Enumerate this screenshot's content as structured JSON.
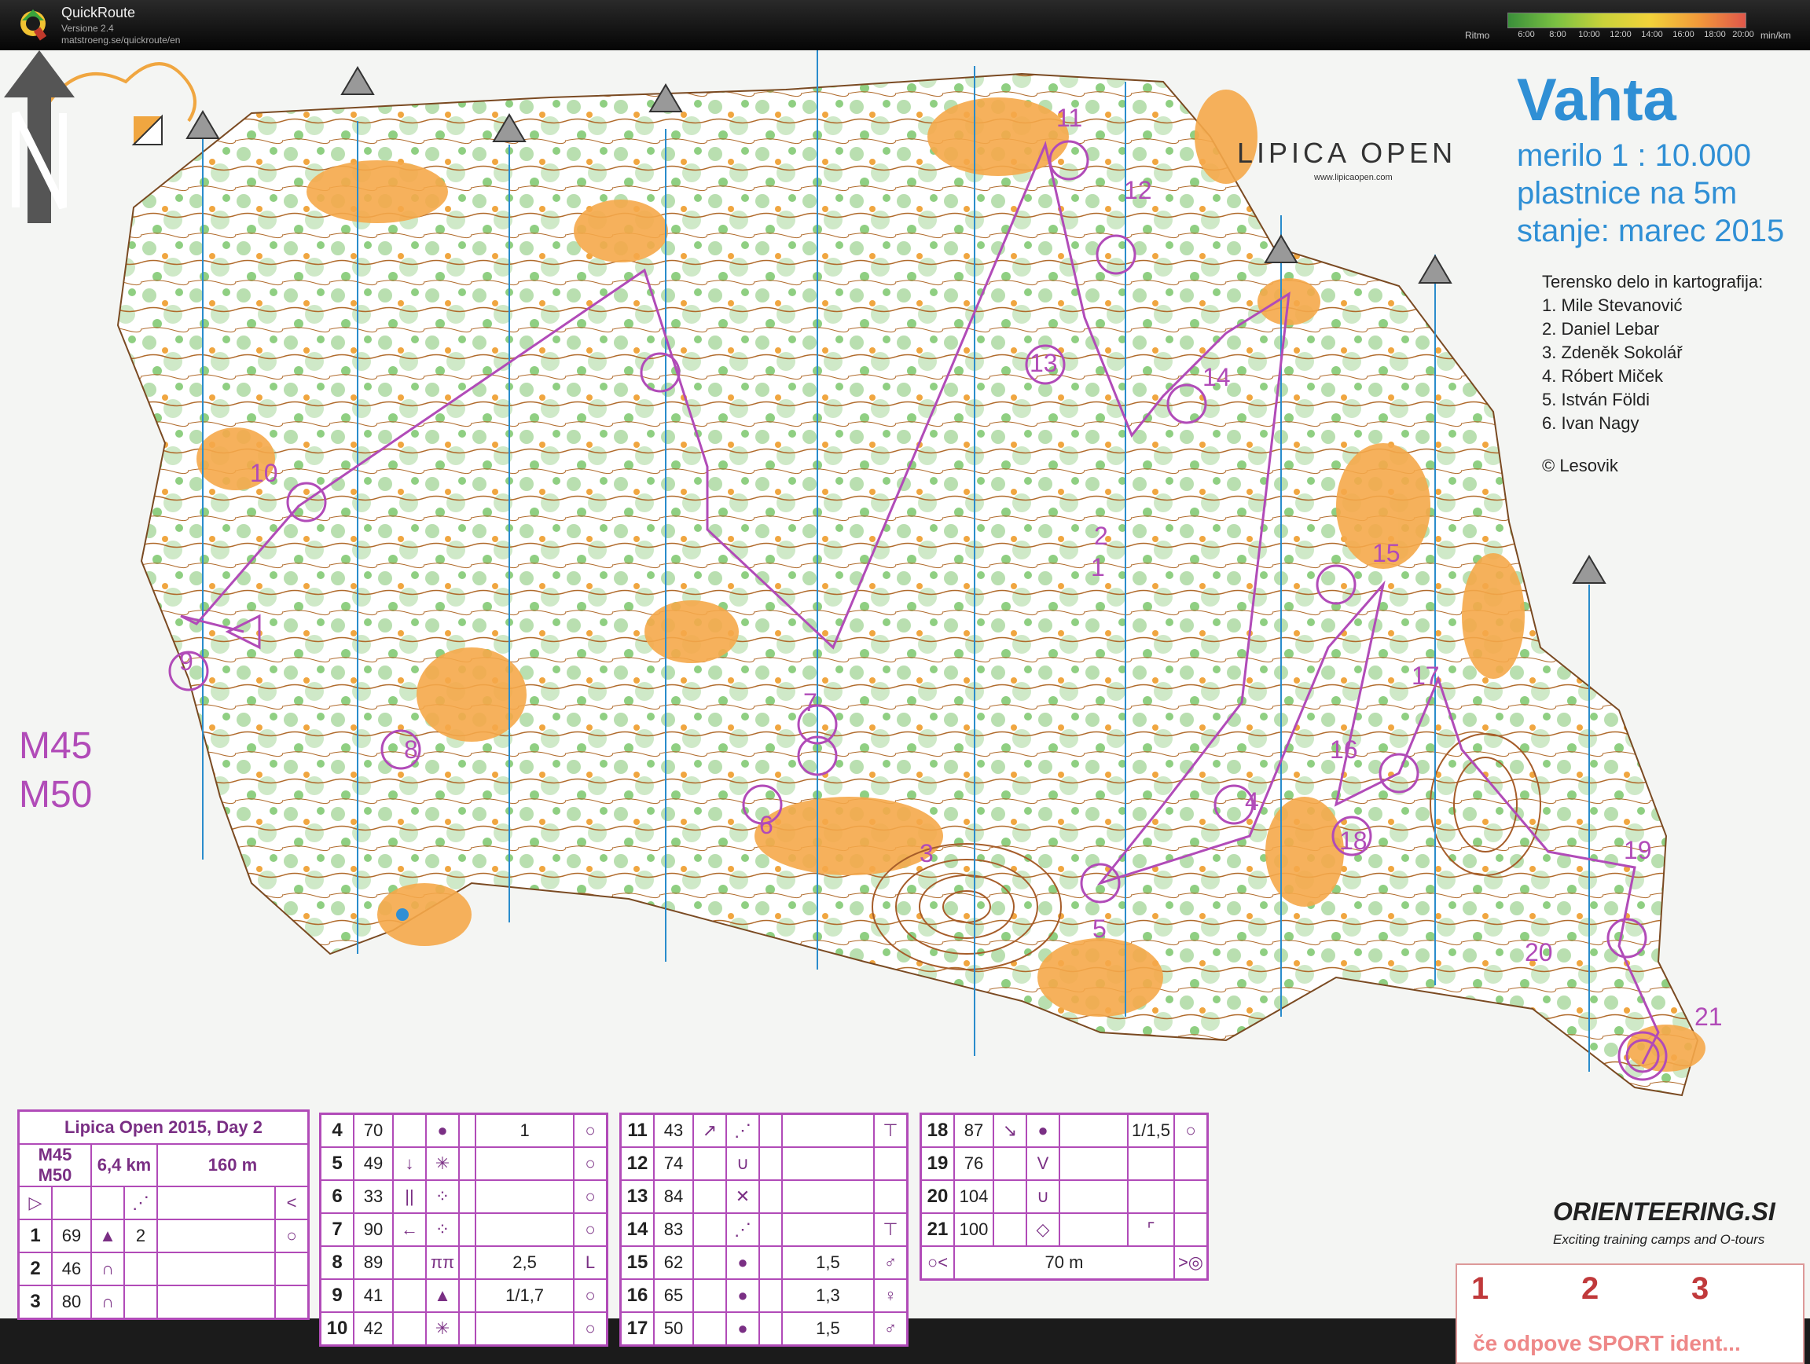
{
  "app": {
    "name": "QuickRoute",
    "version": "Versione 2.4",
    "url": "matstroeng.se/quickroute/en",
    "logo_letter": "Q"
  },
  "pace_legend": {
    "label": "Ritmo",
    "unit": "min/km",
    "ticks": [
      "6:00",
      "8:00",
      "10:00",
      "12:00",
      "14:00",
      "16:00",
      "18:00",
      "20:00"
    ]
  },
  "map": {
    "title": "Vahta",
    "scale": "merilo 1 : 10.000",
    "contours": "plastnice na 5m",
    "status": "stanje: marec 2015",
    "credits_title": "Terensko delo in kartografija:",
    "credits": [
      "1. Mile Stevanović",
      "2. Daniel Lebar",
      "3. Zdeněk Sokolář",
      "4. Róbert Miček",
      "5. István Földi",
      "6. Ivan Nagy"
    ],
    "copyright": "© Lesovik",
    "classes": [
      "M45",
      "M50"
    ],
    "lipica_logo": "LIPICA OPEN",
    "lipica_url": "www.lipicaopen.com",
    "control_numbers": [
      "1",
      "2",
      "3",
      "4",
      "5",
      "6",
      "7",
      "8",
      "9",
      "10",
      "11",
      "12",
      "13",
      "14",
      "15",
      "16",
      "17",
      "18",
      "19",
      "20",
      "21"
    ]
  },
  "control_description": {
    "event": "Lipica Open 2015, Day 2",
    "classes": "M45 M50",
    "class_a": "M45",
    "class_b": "M50",
    "length": "6,4 km",
    "climb": "160 m",
    "controls": [
      {
        "n": "1",
        "code": "69",
        "feature": "▲",
        "extra": "2",
        "loc": "○"
      },
      {
        "n": "2",
        "code": "46",
        "feature": "∩",
        "extra": "",
        "loc": ""
      },
      {
        "n": "3",
        "code": "80",
        "feature": "∩",
        "extra": "",
        "loc": ""
      },
      {
        "n": "4",
        "code": "70",
        "feature": "●",
        "extra": "1",
        "loc": "○"
      },
      {
        "n": "5",
        "code": "49",
        "feature": "✳",
        "extra": "",
        "loc": "○"
      },
      {
        "n": "6",
        "code": "33",
        "feature": "⁘",
        "extra": "",
        "loc": "○"
      },
      {
        "n": "7",
        "code": "90",
        "feature": "⁘",
        "extra": "",
        "loc": "○"
      },
      {
        "n": "8",
        "code": "89",
        "feature": "ππ",
        "extra": "2,5",
        "loc": "L"
      },
      {
        "n": "9",
        "code": "41",
        "feature": "▲",
        "extra": "1/1,7",
        "loc": "○"
      },
      {
        "n": "10",
        "code": "42",
        "feature": "✳",
        "extra": "",
        "loc": "○"
      },
      {
        "n": "11",
        "code": "43",
        "feature": "⋰",
        "extra": "",
        "loc": "⊤"
      },
      {
        "n": "12",
        "code": "74",
        "feature": "",
        "extra": "",
        "loc": "∪"
      },
      {
        "n": "13",
        "code": "84",
        "feature": "",
        "extra": "",
        "loc": "✕"
      },
      {
        "n": "14",
        "code": "83",
        "feature": "⋰",
        "extra": "",
        "loc": "⊤"
      },
      {
        "n": "15",
        "code": "62",
        "feature": "●",
        "extra": "1,5",
        "loc": "♂"
      },
      {
        "n": "16",
        "code": "65",
        "feature": "●",
        "extra": "1,3",
        "loc": "♀"
      },
      {
        "n": "17",
        "code": "50",
        "feature": "●",
        "extra": "1,5",
        "loc": "♂"
      },
      {
        "n": "18",
        "code": "87",
        "feature": "●",
        "extra": "1/1,5",
        "loc": "○"
      },
      {
        "n": "19",
        "code": "76",
        "feature": "",
        "extra": "",
        "loc": "V"
      },
      {
        "n": "20",
        "code": "104",
        "feature": "",
        "extra": "",
        "loc": "∪"
      },
      {
        "n": "21",
        "code": "100",
        "feature": "",
        "extra": "",
        "loc": "◇"
      }
    ],
    "finish_distance": "70 m"
  },
  "sponsor": {
    "name": "ORIENTEERING.SI",
    "tagline": "Exciting training camps and O-tours"
  },
  "sport_ident": {
    "cells": [
      "1",
      "2",
      "3"
    ],
    "text": "če odpove SPORT ident..."
  }
}
